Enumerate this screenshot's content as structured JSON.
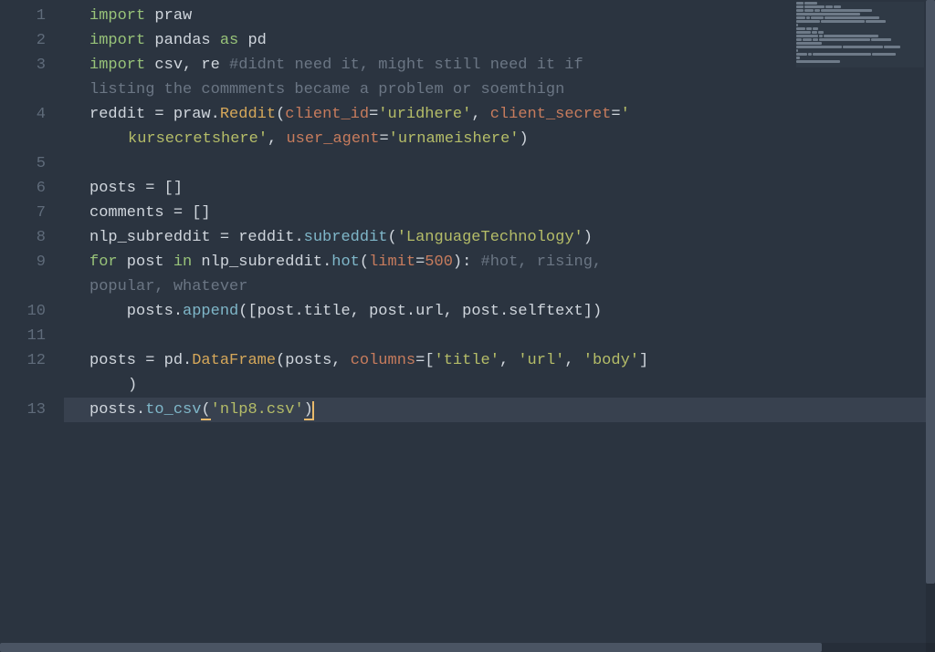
{
  "colors": {
    "background": "#2b3440",
    "gutter_fg": "#5f6b7a",
    "default_fg": "#d0d6dd",
    "keyword": "#98c379",
    "function": "#7fb7c9",
    "class": "#d6a85a",
    "string": "#b5bd68",
    "number": "#c77c5d",
    "comment": "#6b7684",
    "kwarg": "#c77c5d",
    "cursor": "#e8b96b"
  },
  "line_numbers": [
    "1",
    "2",
    "3",
    "4",
    "5",
    "6",
    "7",
    "8",
    "9",
    "10",
    "11",
    "12",
    "13"
  ],
  "current_line_index": 17,
  "code_rows": [
    {
      "ln": "1",
      "indent": "line",
      "tokens": [
        [
          "kw",
          "import"
        ],
        [
          "id",
          " praw"
        ]
      ]
    },
    {
      "ln": "2",
      "indent": "line",
      "tokens": [
        [
          "kw",
          "import"
        ],
        [
          "id",
          " pandas "
        ],
        [
          "kw",
          "as"
        ],
        [
          "id",
          " pd"
        ]
      ]
    },
    {
      "ln": "3",
      "indent": "line",
      "tokens": [
        [
          "kw",
          "import"
        ],
        [
          "id",
          " csv"
        ],
        [
          "punc",
          ","
        ],
        [
          "id",
          " re "
        ],
        [
          "cmt",
          "#didnt need it, might still need it if "
        ]
      ]
    },
    {
      "ln": "",
      "indent": "line wrap2",
      "tokens": [
        [
          "cmt",
          "listing the commments became a problem or soemthign"
        ]
      ]
    },
    {
      "ln": "4",
      "indent": "line",
      "tokens": [
        [
          "id",
          "reddit "
        ],
        [
          "op",
          "="
        ],
        [
          "id",
          " praw"
        ],
        [
          "punc",
          "."
        ],
        [
          "cls",
          "Reddit"
        ],
        [
          "punc",
          "("
        ],
        [
          "kwarg",
          "client_id"
        ],
        [
          "op",
          "="
        ],
        [
          "str",
          "'uridhere'"
        ],
        [
          "punc",
          ", "
        ],
        [
          "kwarg",
          "client_secret"
        ],
        [
          "op",
          "="
        ],
        [
          "str",
          "'"
        ]
      ]
    },
    {
      "ln": "",
      "indent": "line wrap",
      "tokens": [
        [
          "str",
          "kursecretshere'"
        ],
        [
          "punc",
          ", "
        ],
        [
          "kwarg",
          "user_agent"
        ],
        [
          "op",
          "="
        ],
        [
          "str",
          "'urnameishere'"
        ],
        [
          "punc",
          ")"
        ]
      ]
    },
    {
      "ln": "5",
      "indent": "line",
      "tokens": []
    },
    {
      "ln": "6",
      "indent": "line",
      "tokens": [
        [
          "id",
          "posts "
        ],
        [
          "op",
          "="
        ],
        [
          "id",
          " "
        ],
        [
          "punc",
          "[]"
        ]
      ]
    },
    {
      "ln": "7",
      "indent": "line",
      "tokens": [
        [
          "id",
          "comments "
        ],
        [
          "op",
          "="
        ],
        [
          "id",
          " "
        ],
        [
          "punc",
          "[]"
        ]
      ]
    },
    {
      "ln": "8",
      "indent": "line",
      "tokens": [
        [
          "id",
          "nlp_subreddit "
        ],
        [
          "op",
          "="
        ],
        [
          "id",
          " reddit"
        ],
        [
          "punc",
          "."
        ],
        [
          "fn",
          "subreddit"
        ],
        [
          "punc",
          "("
        ],
        [
          "str",
          "'LanguageTechnology'"
        ],
        [
          "punc",
          ")"
        ]
      ]
    },
    {
      "ln": "9",
      "indent": "line",
      "tokens": [
        [
          "kw",
          "for"
        ],
        [
          "id",
          " post "
        ],
        [
          "kw",
          "in"
        ],
        [
          "id",
          " nlp_subreddit"
        ],
        [
          "punc",
          "."
        ],
        [
          "fn",
          "hot"
        ],
        [
          "punc",
          "("
        ],
        [
          "kwarg",
          "limit"
        ],
        [
          "op",
          "="
        ],
        [
          "num",
          "500"
        ],
        [
          "punc",
          "): "
        ],
        [
          "cmt",
          "#hot, rising, "
        ]
      ]
    },
    {
      "ln": "",
      "indent": "line wrap2",
      "tokens": [
        [
          "cmt",
          "popular, whatever"
        ]
      ]
    },
    {
      "ln": "10",
      "indent": "line",
      "tokens": [
        [
          "id",
          "    posts"
        ],
        [
          "punc",
          "."
        ],
        [
          "fn",
          "append"
        ],
        [
          "punc",
          "(["
        ],
        [
          "id",
          "post"
        ],
        [
          "punc",
          "."
        ],
        [
          "attr",
          "title"
        ],
        [
          "punc",
          ", "
        ],
        [
          "id",
          "post"
        ],
        [
          "punc",
          "."
        ],
        [
          "attr",
          "url"
        ],
        [
          "punc",
          ", "
        ],
        [
          "id",
          "post"
        ],
        [
          "punc",
          "."
        ],
        [
          "attr",
          "selftext"
        ],
        [
          "punc",
          "])"
        ]
      ]
    },
    {
      "ln": "11",
      "indent": "line",
      "tokens": []
    },
    {
      "ln": "12",
      "indent": "line",
      "tokens": [
        [
          "id",
          "posts "
        ],
        [
          "op",
          "="
        ],
        [
          "id",
          " pd"
        ],
        [
          "punc",
          "."
        ],
        [
          "cls",
          "DataFrame"
        ],
        [
          "punc",
          "("
        ],
        [
          "id",
          "posts"
        ],
        [
          "punc",
          ", "
        ],
        [
          "kwarg",
          "columns"
        ],
        [
          "op",
          "="
        ],
        [
          "punc",
          "["
        ],
        [
          "str",
          "'title'"
        ],
        [
          "punc",
          ", "
        ],
        [
          "str",
          "'url'"
        ],
        [
          "punc",
          ", "
        ],
        [
          "str",
          "'body'"
        ],
        [
          "punc",
          "]"
        ]
      ]
    },
    {
      "ln": "",
      "indent": "line wrap",
      "tokens": [
        [
          "punc",
          ")"
        ]
      ]
    },
    {
      "ln": "13",
      "indent": "line current-line",
      "tokens": [
        [
          "id",
          "posts"
        ],
        [
          "punc",
          "."
        ],
        [
          "fn",
          "to_csv"
        ],
        [
          "punc_hl",
          "("
        ],
        [
          "str",
          "'nlp8.csv'"
        ],
        [
          "punc_hl",
          ")"
        ],
        [
          "cursor",
          ""
        ]
      ]
    }
  ],
  "minimap_rows": [
    [
      8,
      14
    ],
    [
      8,
      22,
      8,
      8
    ],
    [
      8,
      10,
      6,
      56
    ],
    [
      70
    ],
    [
      10,
      4,
      14,
      60
    ],
    [
      26,
      48,
      22
    ],
    [
      2
    ],
    [
      10,
      6,
      6
    ],
    [
      16,
      6,
      6
    ],
    [
      24,
      4,
      60
    ],
    [
      6,
      10,
      6,
      56,
      22
    ],
    [
      28
    ],
    [
      50,
      44,
      18
    ],
    [
      2
    ],
    [
      12,
      4,
      64,
      26
    ],
    [
      4
    ],
    [
      48
    ]
  ]
}
